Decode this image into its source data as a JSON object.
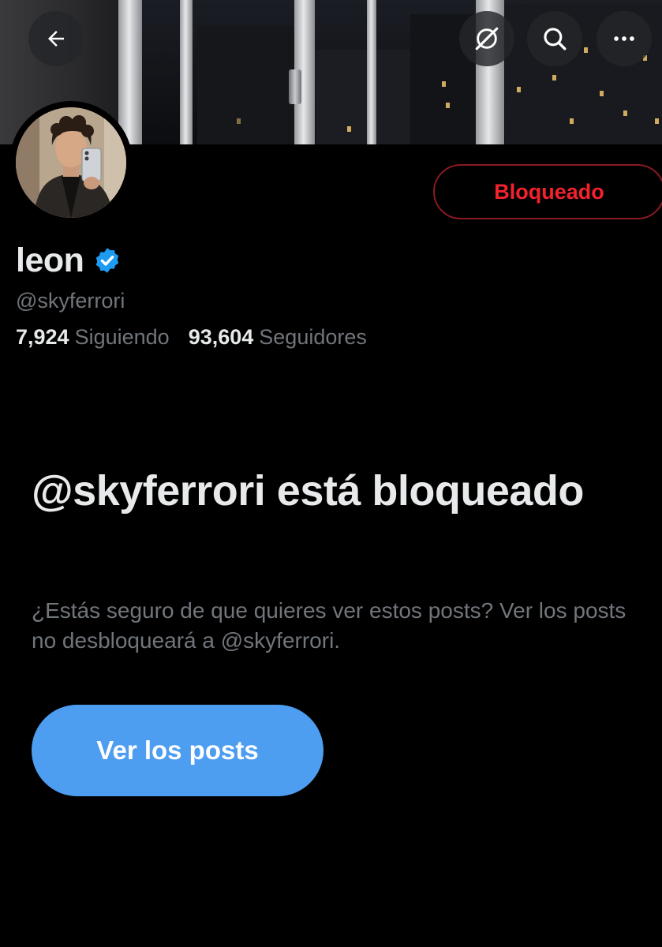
{
  "header": {
    "back_icon": "arrow-left-icon",
    "grok_icon": "grok-icon",
    "search_icon": "search-icon",
    "more_icon": "more-horizontal-icon"
  },
  "profile": {
    "display_name": "leon",
    "verified": true,
    "handle": "@skyferrori",
    "block_button_label": "Bloqueado",
    "following_count": "7,924",
    "following_label": "Siguiendo",
    "followers_count": "93,604",
    "followers_label": "Seguidores"
  },
  "blocked_notice": {
    "title": "@skyferrori está bloqueado",
    "description": "¿Estás seguro de que quieres ver estos posts? Ver los posts no desbloqueará a @skyferrori.",
    "view_posts_label": "Ver los posts"
  },
  "colors": {
    "background": "#000000",
    "primary_text": "#e7e9ea",
    "secondary_text": "#71767b",
    "danger": "#f4212e",
    "accent": "#4d9df0",
    "verified": "#1d9bf0"
  }
}
